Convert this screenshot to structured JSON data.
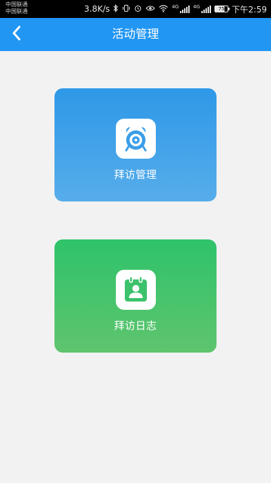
{
  "status_bar": {
    "carrier_line1": "中国联通",
    "carrier_line2": "中国联通",
    "network_speed": "3.8K/s",
    "network_type_1": "4G",
    "network_type_2": "4G",
    "battery_level": "75",
    "time": "下午2:59"
  },
  "header": {
    "title": "活动管理",
    "back_icon": "chevron-left-icon"
  },
  "cards": [
    {
      "label": "拜访管理",
      "icon": "alarm-clock-icon",
      "color": "#3a9ee9"
    },
    {
      "label": "拜访日志",
      "icon": "calendar-contact-icon",
      "color": "#3cc26c"
    }
  ],
  "colors": {
    "accent": "#2196f3",
    "background": "#f2f2f2",
    "status_bar": "#000000"
  }
}
